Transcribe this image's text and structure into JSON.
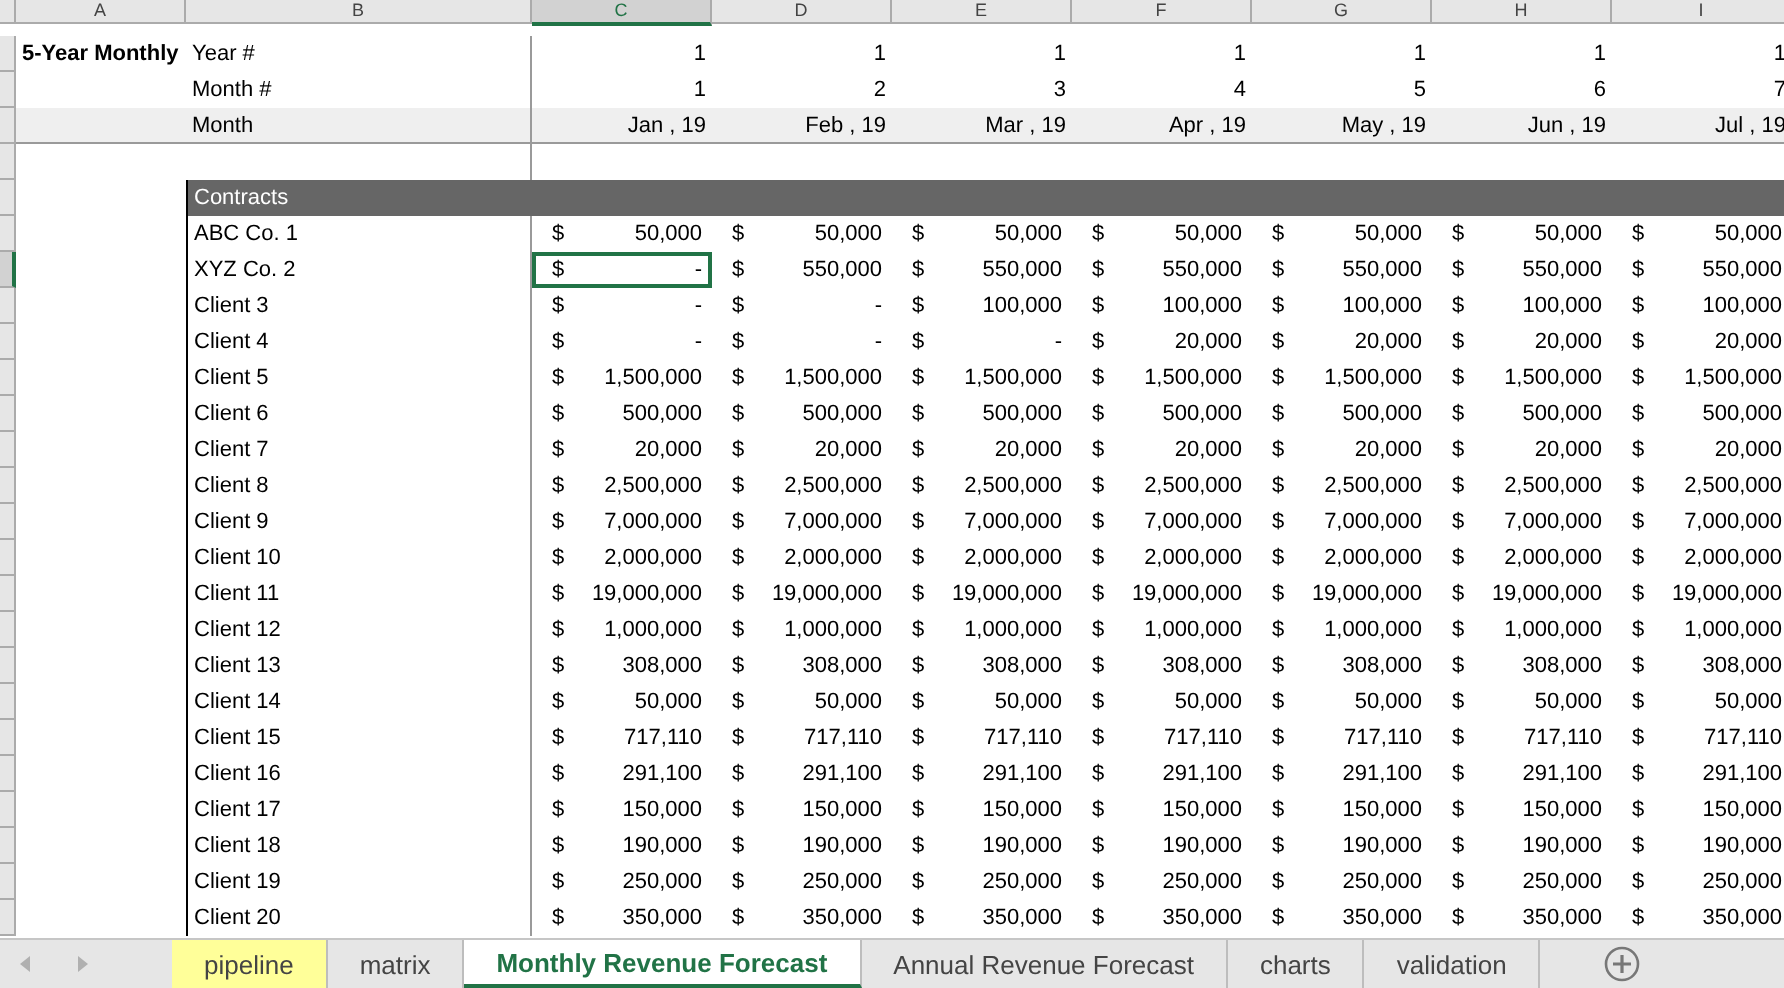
{
  "columns": [
    {
      "label": "A",
      "selected": false
    },
    {
      "label": "B",
      "selected": false
    },
    {
      "label": "C",
      "selected": true
    },
    {
      "label": "D",
      "selected": false
    },
    {
      "label": "E",
      "selected": false
    },
    {
      "label": "F",
      "selected": false
    },
    {
      "label": "G",
      "selected": false
    },
    {
      "label": "H",
      "selected": false
    },
    {
      "label": "I",
      "selected": false
    }
  ],
  "title": "5-Year Monthly",
  "header_rows": [
    {
      "label": "Year #",
      "shaded": false,
      "values": [
        "1",
        "1",
        "1",
        "1",
        "1",
        "1",
        "1"
      ]
    },
    {
      "label": "Month #",
      "shaded": false,
      "values": [
        "1",
        "2",
        "3",
        "4",
        "5",
        "6",
        "7"
      ]
    },
    {
      "label": "Month",
      "shaded": true,
      "values": [
        "Jan , 19",
        "Feb , 19",
        "Mar , 19",
        "Apr , 19",
        "May , 19",
        "Jun , 19",
        "Jul , 19"
      ]
    }
  ],
  "section": "Contracts",
  "rows": [
    {
      "name": "ABC Co. 1",
      "selected": false,
      "cells": [
        [
          "$",
          "50,000"
        ],
        [
          "$",
          "50,000"
        ],
        [
          "$",
          "50,000"
        ],
        [
          "$",
          "50,000"
        ],
        [
          "$",
          "50,000"
        ],
        [
          "$",
          "50,000"
        ],
        [
          "$",
          "50,000"
        ]
      ]
    },
    {
      "name": "XYZ Co. 2",
      "selected": true,
      "cells": [
        [
          "$",
          "-"
        ],
        [
          "$",
          "550,000"
        ],
        [
          "$",
          "550,000"
        ],
        [
          "$",
          "550,000"
        ],
        [
          "$",
          "550,000"
        ],
        [
          "$",
          "550,000"
        ],
        [
          "$",
          "550,000"
        ]
      ]
    },
    {
      "name": "Client 3",
      "selected": false,
      "cells": [
        [
          "$",
          "-"
        ],
        [
          "$",
          "-"
        ],
        [
          "$",
          "100,000"
        ],
        [
          "$",
          "100,000"
        ],
        [
          "$",
          "100,000"
        ],
        [
          "$",
          "100,000"
        ],
        [
          "$",
          "100,000"
        ]
      ]
    },
    {
      "name": "Client 4",
      "selected": false,
      "cells": [
        [
          "$",
          "-"
        ],
        [
          "$",
          "-"
        ],
        [
          "$",
          "-"
        ],
        [
          "$",
          "20,000"
        ],
        [
          "$",
          "20,000"
        ],
        [
          "$",
          "20,000"
        ],
        [
          "$",
          "20,000"
        ]
      ]
    },
    {
      "name": "Client 5",
      "selected": false,
      "cells": [
        [
          "$",
          "1,500,000"
        ],
        [
          "$",
          "1,500,000"
        ],
        [
          "$",
          "1,500,000"
        ],
        [
          "$",
          "1,500,000"
        ],
        [
          "$",
          "1,500,000"
        ],
        [
          "$",
          "1,500,000"
        ],
        [
          "$",
          "1,500,000"
        ]
      ]
    },
    {
      "name": "Client 6",
      "selected": false,
      "cells": [
        [
          "$",
          "500,000"
        ],
        [
          "$",
          "500,000"
        ],
        [
          "$",
          "500,000"
        ],
        [
          "$",
          "500,000"
        ],
        [
          "$",
          "500,000"
        ],
        [
          "$",
          "500,000"
        ],
        [
          "$",
          "500,000"
        ]
      ]
    },
    {
      "name": "Client 7",
      "selected": false,
      "cells": [
        [
          "$",
          "20,000"
        ],
        [
          "$",
          "20,000"
        ],
        [
          "$",
          "20,000"
        ],
        [
          "$",
          "20,000"
        ],
        [
          "$",
          "20,000"
        ],
        [
          "$",
          "20,000"
        ],
        [
          "$",
          "20,000"
        ]
      ]
    },
    {
      "name": "Client 8",
      "selected": false,
      "cells": [
        [
          "$",
          "2,500,000"
        ],
        [
          "$",
          "2,500,000"
        ],
        [
          "$",
          "2,500,000"
        ],
        [
          "$",
          "2,500,000"
        ],
        [
          "$",
          "2,500,000"
        ],
        [
          "$",
          "2,500,000"
        ],
        [
          "$",
          "2,500,000"
        ]
      ]
    },
    {
      "name": "Client 9",
      "selected": false,
      "cells": [
        [
          "$",
          "7,000,000"
        ],
        [
          "$",
          "7,000,000"
        ],
        [
          "$",
          "7,000,000"
        ],
        [
          "$",
          "7,000,000"
        ],
        [
          "$",
          "7,000,000"
        ],
        [
          "$",
          "7,000,000"
        ],
        [
          "$",
          "7,000,000"
        ]
      ]
    },
    {
      "name": "Client 10",
      "selected": false,
      "cells": [
        [
          "$",
          "2,000,000"
        ],
        [
          "$",
          "2,000,000"
        ],
        [
          "$",
          "2,000,000"
        ],
        [
          "$",
          "2,000,000"
        ],
        [
          "$",
          "2,000,000"
        ],
        [
          "$",
          "2,000,000"
        ],
        [
          "$",
          "2,000,000"
        ]
      ]
    },
    {
      "name": "Client 11",
      "selected": false,
      "cells": [
        [
          "$",
          "19,000,000"
        ],
        [
          "$",
          "19,000,000"
        ],
        [
          "$",
          "19,000,000"
        ],
        [
          "$",
          "19,000,000"
        ],
        [
          "$",
          "19,000,000"
        ],
        [
          "$",
          "19,000,000"
        ],
        [
          "$",
          "19,000,000"
        ]
      ]
    },
    {
      "name": "Client 12",
      "selected": false,
      "cells": [
        [
          "$",
          "1,000,000"
        ],
        [
          "$",
          "1,000,000"
        ],
        [
          "$",
          "1,000,000"
        ],
        [
          "$",
          "1,000,000"
        ],
        [
          "$",
          "1,000,000"
        ],
        [
          "$",
          "1,000,000"
        ],
        [
          "$",
          "1,000,000"
        ]
      ]
    },
    {
      "name": "Client 13",
      "selected": false,
      "cells": [
        [
          "$",
          "308,000"
        ],
        [
          "$",
          "308,000"
        ],
        [
          "$",
          "308,000"
        ],
        [
          "$",
          "308,000"
        ],
        [
          "$",
          "308,000"
        ],
        [
          "$",
          "308,000"
        ],
        [
          "$",
          "308,000"
        ]
      ]
    },
    {
      "name": "Client 14",
      "selected": false,
      "cells": [
        [
          "$",
          "50,000"
        ],
        [
          "$",
          "50,000"
        ],
        [
          "$",
          "50,000"
        ],
        [
          "$",
          "50,000"
        ],
        [
          "$",
          "50,000"
        ],
        [
          "$",
          "50,000"
        ],
        [
          "$",
          "50,000"
        ]
      ]
    },
    {
      "name": "Client 15",
      "selected": false,
      "cells": [
        [
          "$",
          "717,110"
        ],
        [
          "$",
          "717,110"
        ],
        [
          "$",
          "717,110"
        ],
        [
          "$",
          "717,110"
        ],
        [
          "$",
          "717,110"
        ],
        [
          "$",
          "717,110"
        ],
        [
          "$",
          "717,110"
        ]
      ]
    },
    {
      "name": "Client 16",
      "selected": false,
      "cells": [
        [
          "$",
          "291,100"
        ],
        [
          "$",
          "291,100"
        ],
        [
          "$",
          "291,100"
        ],
        [
          "$",
          "291,100"
        ],
        [
          "$",
          "291,100"
        ],
        [
          "$",
          "291,100"
        ],
        [
          "$",
          "291,100"
        ]
      ]
    },
    {
      "name": "Client 17",
      "selected": false,
      "cells": [
        [
          "$",
          "150,000"
        ],
        [
          "$",
          "150,000"
        ],
        [
          "$",
          "150,000"
        ],
        [
          "$",
          "150,000"
        ],
        [
          "$",
          "150,000"
        ],
        [
          "$",
          "150,000"
        ],
        [
          "$",
          "150,000"
        ]
      ]
    },
    {
      "name": "Client 18",
      "selected": false,
      "cells": [
        [
          "$",
          "190,000"
        ],
        [
          "$",
          "190,000"
        ],
        [
          "$",
          "190,000"
        ],
        [
          "$",
          "190,000"
        ],
        [
          "$",
          "190,000"
        ],
        [
          "$",
          "190,000"
        ],
        [
          "$",
          "190,000"
        ]
      ]
    },
    {
      "name": "Client 19",
      "selected": false,
      "cells": [
        [
          "$",
          "250,000"
        ],
        [
          "$",
          "250,000"
        ],
        [
          "$",
          "250,000"
        ],
        [
          "$",
          "250,000"
        ],
        [
          "$",
          "250,000"
        ],
        [
          "$",
          "250,000"
        ],
        [
          "$",
          "250,000"
        ]
      ]
    },
    {
      "name": "Client 20",
      "selected": false,
      "cells": [
        [
          "$",
          "350,000"
        ],
        [
          "$",
          "350,000"
        ],
        [
          "$",
          "350,000"
        ],
        [
          "$",
          "350,000"
        ],
        [
          "$",
          "350,000"
        ],
        [
          "$",
          "350,000"
        ],
        [
          "$",
          "350,000"
        ]
      ]
    }
  ],
  "sheet_tabs": [
    {
      "label": "pipeline",
      "selected": false,
      "color": "#ffff99"
    },
    {
      "label": "matrix",
      "selected": false
    },
    {
      "label": "Monthly Revenue Forecast",
      "selected": true
    },
    {
      "label": "Annual Revenue Forecast",
      "selected": false
    },
    {
      "label": "charts",
      "selected": false
    },
    {
      "label": "validation",
      "selected": false
    }
  ]
}
